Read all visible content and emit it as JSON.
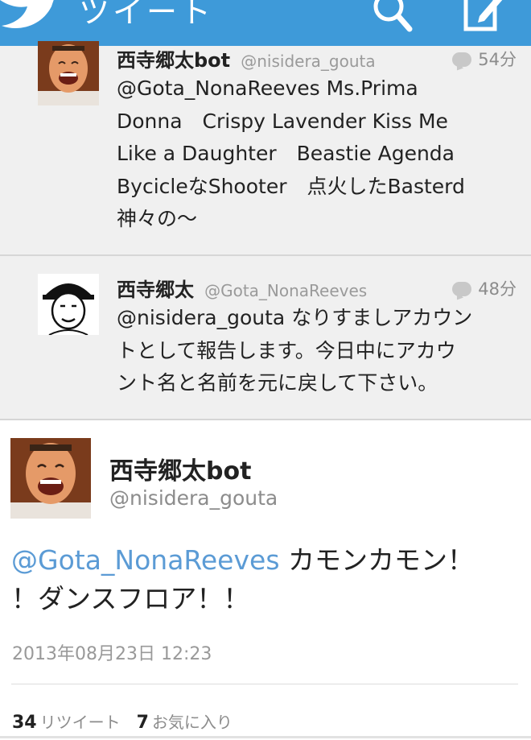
{
  "topbar": {
    "title": "ツイート",
    "color": "#3e9ad9",
    "icons": [
      "twitter-bird-icon",
      "search-icon",
      "compose-icon"
    ]
  },
  "timeline": [
    {
      "name": "西寺郷太bot",
      "handle": "@nisidera_gouta",
      "time": "54分",
      "lines": [
        "@Gota_NonaReeves Ms.Prima",
        "Donna　Crispy Lavender  Kiss Me",
        "Like a Daughter　Beastie Agenda",
        "BycicleなShooter　点火したBasterd",
        "神々の～"
      ]
    },
    {
      "name": "西寺郷太",
      "handle": "@Gota_NonaReeves",
      "time": "48分",
      "lines": [
        "@nisidera_gouta なりすましアカウン",
        "トとして報告します。今日中にアカウ",
        "ント名と名前を元に戻して下さい。"
      ]
    }
  ],
  "detail": {
    "name": "西寺郷太bot",
    "handle": "@nisidera_gouta",
    "mention": "@Gota_NonaReeves",
    "text_line1": " カモンカモン！",
    "text_line2": "！ダンスフロア！！",
    "date": "2013年08月23日 12:23",
    "retweets": "34",
    "retweets_label": "リツイート",
    "favorites": "7",
    "favorites_label": "お気に入り",
    "mention_color": "#5b9bd5"
  }
}
